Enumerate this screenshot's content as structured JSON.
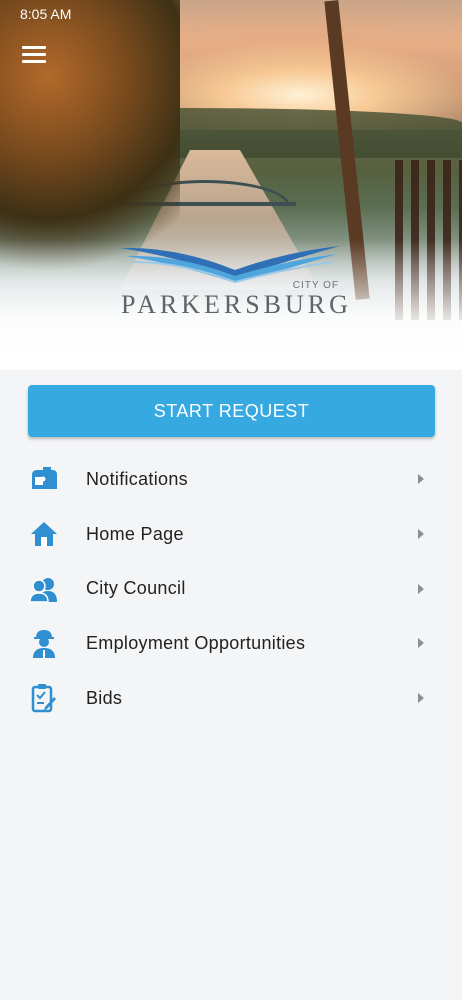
{
  "status_bar": {
    "time": "8:05 AM"
  },
  "header": {
    "logo_small_text": "CITY OF",
    "logo_name": "PARKERSBURG"
  },
  "start_button": {
    "label": "START REQUEST"
  },
  "menu": {
    "items": [
      {
        "label": "Notifications",
        "icon": "mailbox-icon"
      },
      {
        "label": "Home Page",
        "icon": "home-icon"
      },
      {
        "label": "City Council",
        "icon": "people-icon"
      },
      {
        "label": "Employment Opportunities",
        "icon": "worker-icon"
      },
      {
        "label": "Bids",
        "icon": "clipboard-edit-icon"
      }
    ]
  },
  "colors": {
    "accent": "#35a9e0",
    "background": "#f4f5f7",
    "text": "#222222"
  }
}
